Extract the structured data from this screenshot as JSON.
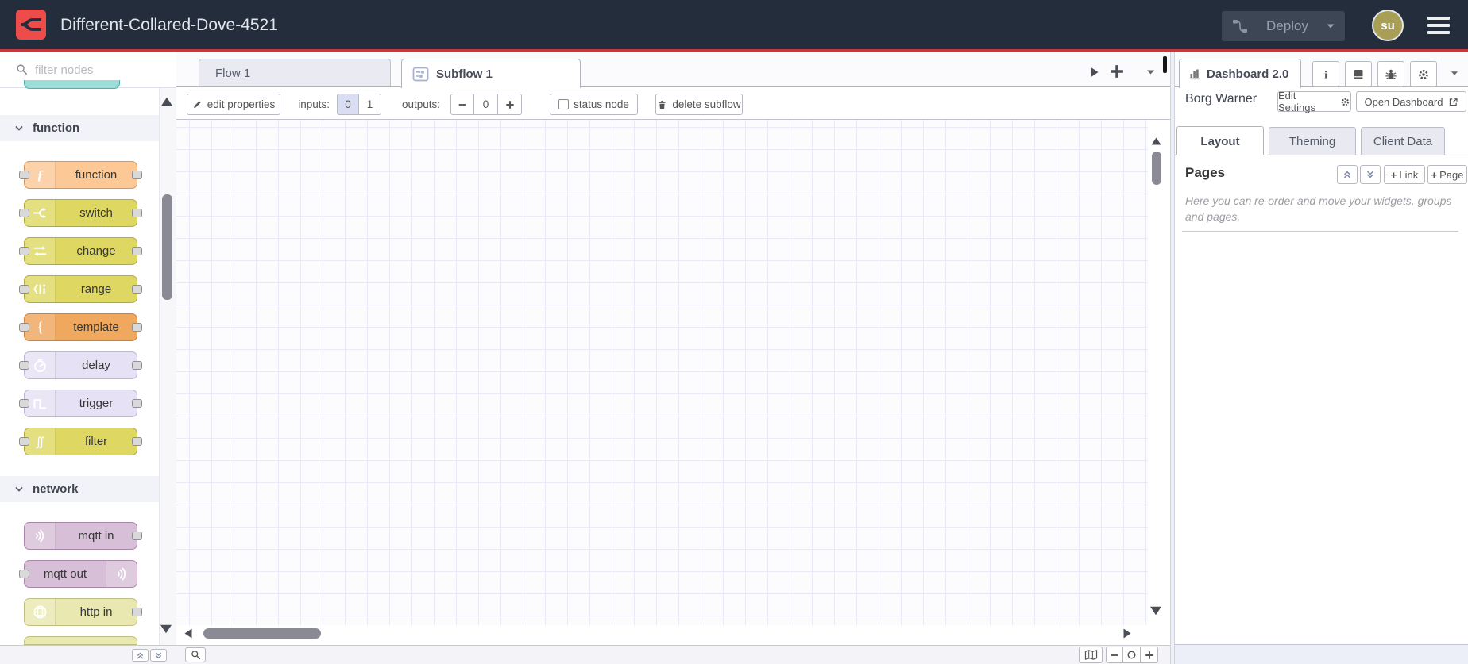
{
  "header": {
    "title": "Different-Collared-Dove-4521",
    "deploy_label": "Deploy",
    "avatar_initials": "su"
  },
  "palette": {
    "search_placeholder": "filter nodes",
    "partial_top": {
      "color": "#9cdcd9",
      "border": "#4fb1ac"
    },
    "categories": [
      {
        "label": "function",
        "nodes": [
          {
            "label": "function",
            "color": "#fbc896",
            "border": "#d19a63",
            "icon": "function-icon",
            "ports": "both",
            "icon_side": "left"
          },
          {
            "label": "switch",
            "color": "#ded863",
            "border": "#b1ab45",
            "icon": "switch-icon",
            "ports": "both",
            "icon_side": "left"
          },
          {
            "label": "change",
            "color": "#ded863",
            "border": "#b1ab45",
            "icon": "change-icon",
            "ports": "both",
            "icon_side": "left"
          },
          {
            "label": "range",
            "color": "#ded863",
            "border": "#b1ab45",
            "icon": "range-icon",
            "ports": "both",
            "icon_side": "left"
          },
          {
            "label": "template",
            "color": "#f0a75e",
            "border": "#cd8340",
            "icon": "template-icon",
            "ports": "both",
            "icon_side": "left"
          },
          {
            "label": "delay",
            "color": "#e6e1f4",
            "border": "#bdb5da",
            "icon": "delay-icon",
            "ports": "both",
            "icon_side": "left"
          },
          {
            "label": "trigger",
            "color": "#e6e1f4",
            "border": "#bdb5da",
            "icon": "trigger-icon",
            "ports": "both",
            "icon_side": "left"
          },
          {
            "label": "filter",
            "color": "#ded863",
            "border": "#b1ab45",
            "icon": "filter-icon",
            "ports": "both",
            "icon_side": "left"
          }
        ]
      },
      {
        "label": "network",
        "nodes": [
          {
            "label": "mqtt in",
            "color": "#d7c0d7",
            "border": "#a986a9",
            "icon": "mqtt-icon",
            "ports": "right",
            "icon_side": "left"
          },
          {
            "label": "mqtt out",
            "color": "#d7c0d7",
            "border": "#a986a9",
            "icon": "mqtt-icon",
            "ports": "left",
            "icon_side": "right"
          },
          {
            "label": "http in",
            "color": "#e8e8b0",
            "border": "#c0c084",
            "icon": "globe-icon",
            "ports": "right",
            "icon_side": "left"
          },
          {
            "label": "",
            "color": "#e8e8b0",
            "border": "#c0c084",
            "icon": "",
            "ports": "none",
            "icon_side": "left",
            "partial": true
          }
        ]
      }
    ]
  },
  "workspace": {
    "tabs": [
      {
        "label": "Flow 1",
        "active": false
      },
      {
        "label": "Subflow 1",
        "active": true
      }
    ],
    "toolbar": {
      "edit_properties": "edit properties",
      "inputs_label": "inputs:",
      "input_options": [
        "0",
        "1"
      ],
      "selected_input": "0",
      "outputs_label": "outputs:",
      "outputs_value": "0",
      "status_node_label": "status node",
      "status_node_checked": false,
      "delete_subflow_label": "delete subflow"
    }
  },
  "sidebar": {
    "tab_label": "Dashboard 2.0",
    "header_icons": [
      "info-icon",
      "book-icon",
      "bug-icon",
      "gear-icon"
    ],
    "instance_name": "Borg Warner",
    "edit_settings_label": "Edit Settings",
    "open_dashboard_label": "Open Dashboard",
    "tabs": [
      {
        "label": "Layout",
        "active": true
      },
      {
        "label": "Theming",
        "active": false
      },
      {
        "label": "Client Data",
        "active": false
      }
    ],
    "pages": {
      "heading": "Pages",
      "add_link_label": "Link",
      "add_page_label": "Page",
      "helper_text": "Here you can re-order and move your widgets, groups and pages."
    }
  },
  "colors": {
    "header_bg": "#232d3c",
    "brand_red": "#ee4c4b",
    "header_underline": "#c03a3e",
    "deploy_button_bg": "#3d4654",
    "deploy_text": "#97a1ad",
    "avatar_bg": "#a89e55",
    "selected_option_bg": "#dadef2",
    "grid_line": "#e9eaf5",
    "canvas_bg": "#fcfcff",
    "scroll_thumb": "#8a8a94"
  },
  "icons_used": [
    "flow-fork-icon",
    "deploy-icon",
    "caret-down-icon",
    "menu-icon",
    "search-icon",
    "chevron-down-icon",
    "function-icon",
    "switch-icon",
    "change-icon",
    "range-icon",
    "template-icon",
    "delay-icon",
    "trigger-icon",
    "filter-icon",
    "mqtt-icon",
    "globe-icon",
    "subflow-icon",
    "chart-icon",
    "info-icon",
    "book-icon",
    "bug-icon",
    "gear-icon",
    "external-link-icon",
    "pencil-icon",
    "trash-icon",
    "map-icon",
    "minus-icon",
    "circle-icon",
    "plus-icon",
    "magnifier-icon",
    "triangle-up-icon",
    "triangle-down-icon",
    "triangle-left-icon",
    "triangle-right-icon",
    "double-chevron-up-icon",
    "double-chevron-down-icon"
  ]
}
